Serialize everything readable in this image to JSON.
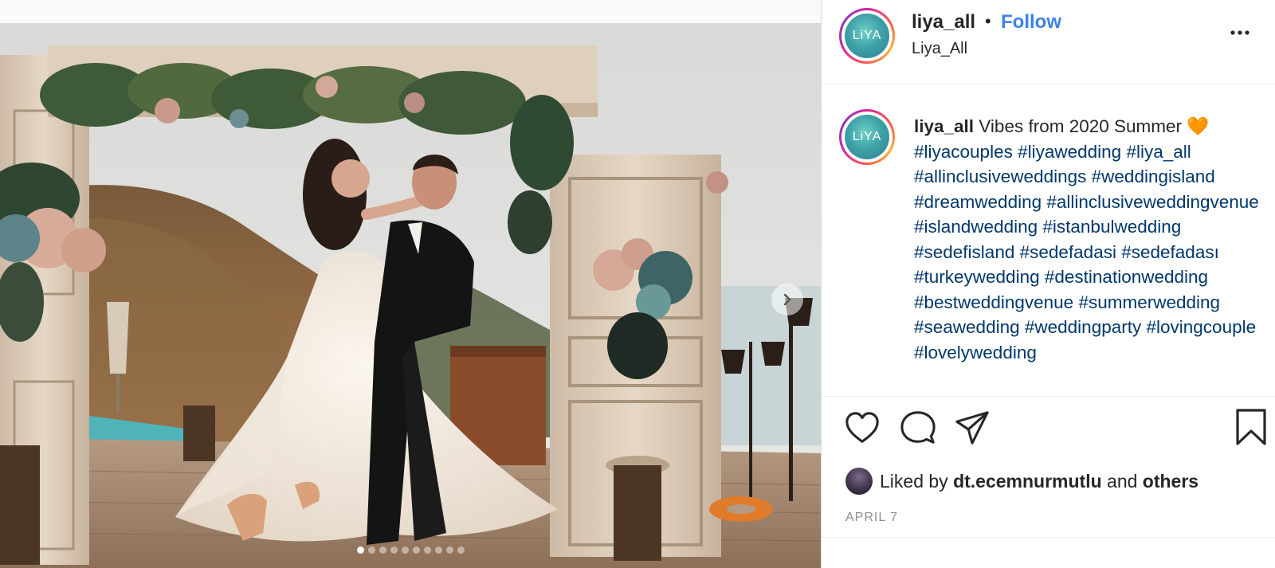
{
  "post": {
    "username": "liya_all",
    "separator": "•",
    "follow_label": "Follow",
    "subtitle": "Liya_All",
    "avatar_text": "LiYA"
  },
  "caption": {
    "username": "liya_all",
    "text": "Vibes from 2020 Summer 🧡",
    "hashtags": [
      "#liyacouples",
      "#liyawedding",
      "#liya_all",
      "#allinclusiveweddings",
      "#weddingisland",
      "#dreamwedding",
      "#allinclusiveweddingvenue",
      "#islandwedding",
      "#istanbulwedding",
      "#sedefisland",
      "#sedefadasi",
      "#sedefadası",
      "#turkeywedding",
      "#destinationwedding",
      "#bestweddingvenue",
      "#summerwedding",
      "#seawedding",
      "#weddingparty",
      "#lovingcouple",
      "#lovelywedding"
    ]
  },
  "likes": {
    "prefix": "Liked by",
    "user": "dt.ecemnurmutlu",
    "connector": "and",
    "others": "others"
  },
  "date": "APRIL 7",
  "carousel": {
    "total": 10,
    "active_index": 0
  },
  "icons": {
    "more": "more-options-icon",
    "like": "heart-icon",
    "comment": "comment-icon",
    "share": "paper-plane-icon",
    "save": "bookmark-icon",
    "next": "chevron-right-icon"
  },
  "colors": {
    "follow": "#3b82e8",
    "hashtag": "#00376b",
    "text": "#262626",
    "muted": "#8e8e8e"
  }
}
